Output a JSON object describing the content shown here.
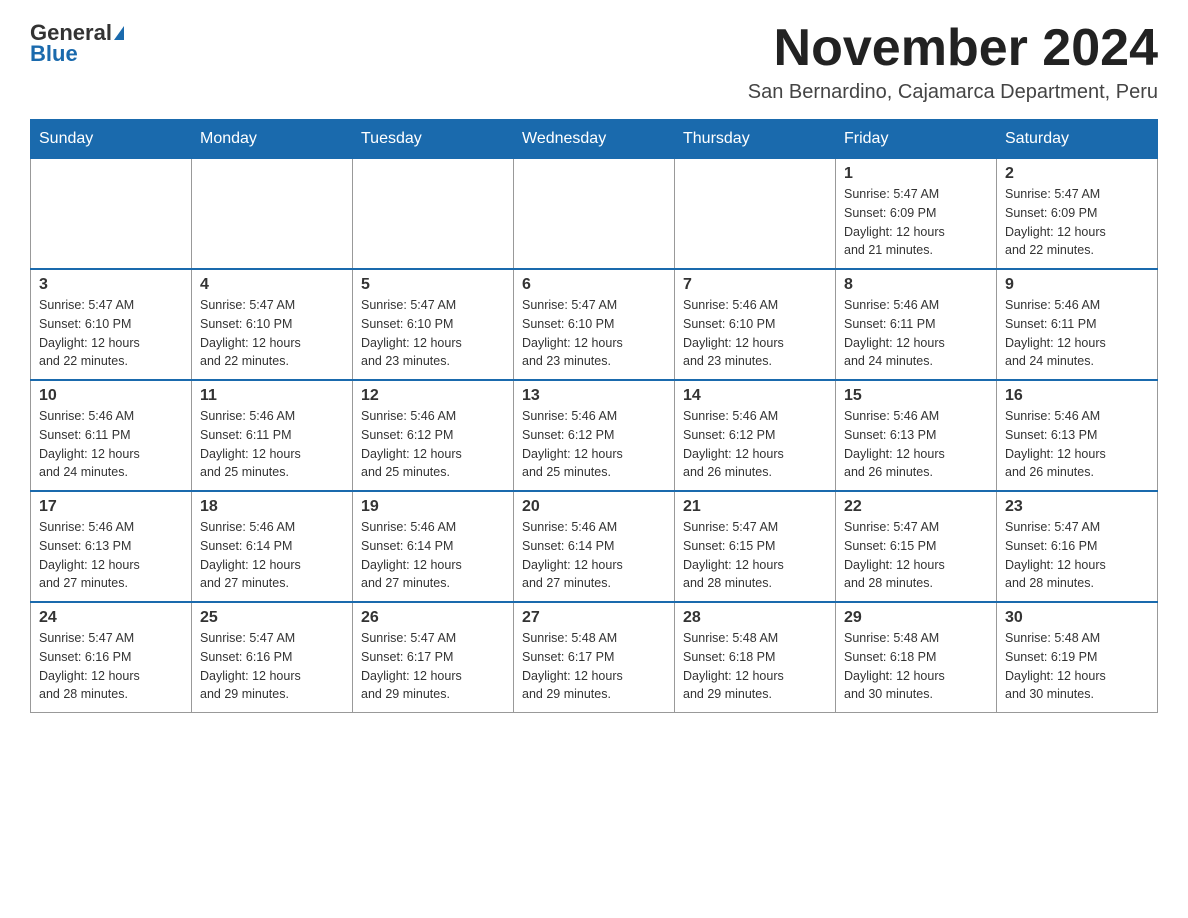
{
  "header": {
    "logo_general": "General",
    "logo_blue": "Blue",
    "month_title": "November 2024",
    "location": "San Bernardino, Cajamarca Department, Peru"
  },
  "weekdays": [
    "Sunday",
    "Monday",
    "Tuesday",
    "Wednesday",
    "Thursday",
    "Friday",
    "Saturday"
  ],
  "weeks": [
    {
      "days": [
        {
          "number": "",
          "info": ""
        },
        {
          "number": "",
          "info": ""
        },
        {
          "number": "",
          "info": ""
        },
        {
          "number": "",
          "info": ""
        },
        {
          "number": "",
          "info": ""
        },
        {
          "number": "1",
          "info": "Sunrise: 5:47 AM\nSunset: 6:09 PM\nDaylight: 12 hours\nand 21 minutes."
        },
        {
          "number": "2",
          "info": "Sunrise: 5:47 AM\nSunset: 6:09 PM\nDaylight: 12 hours\nand 22 minutes."
        }
      ]
    },
    {
      "days": [
        {
          "number": "3",
          "info": "Sunrise: 5:47 AM\nSunset: 6:10 PM\nDaylight: 12 hours\nand 22 minutes."
        },
        {
          "number": "4",
          "info": "Sunrise: 5:47 AM\nSunset: 6:10 PM\nDaylight: 12 hours\nand 22 minutes."
        },
        {
          "number": "5",
          "info": "Sunrise: 5:47 AM\nSunset: 6:10 PM\nDaylight: 12 hours\nand 23 minutes."
        },
        {
          "number": "6",
          "info": "Sunrise: 5:47 AM\nSunset: 6:10 PM\nDaylight: 12 hours\nand 23 minutes."
        },
        {
          "number": "7",
          "info": "Sunrise: 5:46 AM\nSunset: 6:10 PM\nDaylight: 12 hours\nand 23 minutes."
        },
        {
          "number": "8",
          "info": "Sunrise: 5:46 AM\nSunset: 6:11 PM\nDaylight: 12 hours\nand 24 minutes."
        },
        {
          "number": "9",
          "info": "Sunrise: 5:46 AM\nSunset: 6:11 PM\nDaylight: 12 hours\nand 24 minutes."
        }
      ]
    },
    {
      "days": [
        {
          "number": "10",
          "info": "Sunrise: 5:46 AM\nSunset: 6:11 PM\nDaylight: 12 hours\nand 24 minutes."
        },
        {
          "number": "11",
          "info": "Sunrise: 5:46 AM\nSunset: 6:11 PM\nDaylight: 12 hours\nand 25 minutes."
        },
        {
          "number": "12",
          "info": "Sunrise: 5:46 AM\nSunset: 6:12 PM\nDaylight: 12 hours\nand 25 minutes."
        },
        {
          "number": "13",
          "info": "Sunrise: 5:46 AM\nSunset: 6:12 PM\nDaylight: 12 hours\nand 25 minutes."
        },
        {
          "number": "14",
          "info": "Sunrise: 5:46 AM\nSunset: 6:12 PM\nDaylight: 12 hours\nand 26 minutes."
        },
        {
          "number": "15",
          "info": "Sunrise: 5:46 AM\nSunset: 6:13 PM\nDaylight: 12 hours\nand 26 minutes."
        },
        {
          "number": "16",
          "info": "Sunrise: 5:46 AM\nSunset: 6:13 PM\nDaylight: 12 hours\nand 26 minutes."
        }
      ]
    },
    {
      "days": [
        {
          "number": "17",
          "info": "Sunrise: 5:46 AM\nSunset: 6:13 PM\nDaylight: 12 hours\nand 27 minutes."
        },
        {
          "number": "18",
          "info": "Sunrise: 5:46 AM\nSunset: 6:14 PM\nDaylight: 12 hours\nand 27 minutes."
        },
        {
          "number": "19",
          "info": "Sunrise: 5:46 AM\nSunset: 6:14 PM\nDaylight: 12 hours\nand 27 minutes."
        },
        {
          "number": "20",
          "info": "Sunrise: 5:46 AM\nSunset: 6:14 PM\nDaylight: 12 hours\nand 27 minutes."
        },
        {
          "number": "21",
          "info": "Sunrise: 5:47 AM\nSunset: 6:15 PM\nDaylight: 12 hours\nand 28 minutes."
        },
        {
          "number": "22",
          "info": "Sunrise: 5:47 AM\nSunset: 6:15 PM\nDaylight: 12 hours\nand 28 minutes."
        },
        {
          "number": "23",
          "info": "Sunrise: 5:47 AM\nSunset: 6:16 PM\nDaylight: 12 hours\nand 28 minutes."
        }
      ]
    },
    {
      "days": [
        {
          "number": "24",
          "info": "Sunrise: 5:47 AM\nSunset: 6:16 PM\nDaylight: 12 hours\nand 28 minutes."
        },
        {
          "number": "25",
          "info": "Sunrise: 5:47 AM\nSunset: 6:16 PM\nDaylight: 12 hours\nand 29 minutes."
        },
        {
          "number": "26",
          "info": "Sunrise: 5:47 AM\nSunset: 6:17 PM\nDaylight: 12 hours\nand 29 minutes."
        },
        {
          "number": "27",
          "info": "Sunrise: 5:48 AM\nSunset: 6:17 PM\nDaylight: 12 hours\nand 29 minutes."
        },
        {
          "number": "28",
          "info": "Sunrise: 5:48 AM\nSunset: 6:18 PM\nDaylight: 12 hours\nand 29 minutes."
        },
        {
          "number": "29",
          "info": "Sunrise: 5:48 AM\nSunset: 6:18 PM\nDaylight: 12 hours\nand 30 minutes."
        },
        {
          "number": "30",
          "info": "Sunrise: 5:48 AM\nSunset: 6:19 PM\nDaylight: 12 hours\nand 30 minutes."
        }
      ]
    }
  ]
}
